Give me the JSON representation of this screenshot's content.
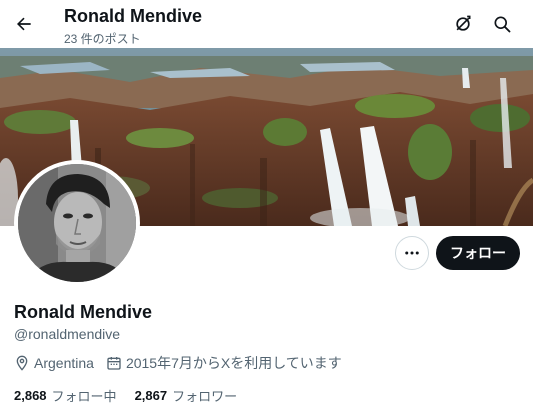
{
  "header": {
    "title": "Ronald Mendive",
    "post_count": "23 件のポスト"
  },
  "profile": {
    "display_name": "Ronald Mendive",
    "handle": "@ronaldmendive",
    "location": "Argentina",
    "joined": "2015年7月からXを利用しています"
  },
  "actions": {
    "follow_label": "フォロー"
  },
  "stats": {
    "following_count": "2,868",
    "following_label": "フォロー中",
    "followers_count": "2,867",
    "followers_label": "フォロワー"
  },
  "colors": {
    "primary_text": "#0f1419",
    "secondary_text": "#536471",
    "follow_button_bg": "#0f1419",
    "border": "#cfd9de"
  },
  "icons": {
    "back": "arrow-left-icon",
    "top_action": "refresh-icon",
    "search": "search-icon",
    "more": "more-icon",
    "location": "location-pin-icon",
    "calendar": "calendar-icon"
  }
}
